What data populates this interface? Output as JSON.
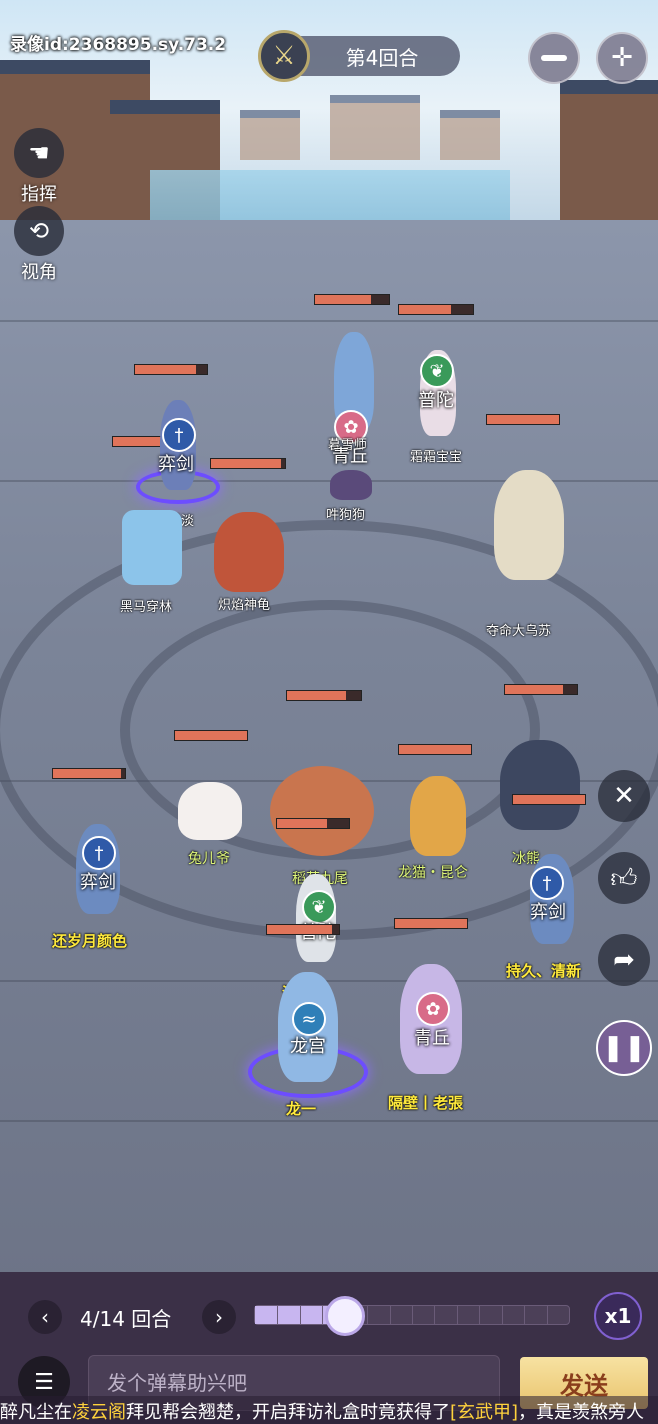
{
  "hud": {
    "replay_id": "录像id:2368895.sy.73.2",
    "round_label": "第4回合",
    "minimize_icon": "minus-icon",
    "fullscreen_icon": "crosshair-icon"
  },
  "side_tools": [
    {
      "label": "指挥",
      "icon": "hand-icon"
    },
    {
      "label": "视角",
      "icon": "camera-angle-icon"
    }
  ],
  "enemy_units": [
    {
      "name": "看淡",
      "school": "弈剑",
      "hp": 0.85
    },
    {
      "name": "黑马穿林",
      "school": "",
      "hp": 0.0
    },
    {
      "name": "炽焰神龟",
      "school": "",
      "hp": 0.95
    },
    {
      "name": "暮雪师",
      "school": "青丘",
      "hp": 0.75
    },
    {
      "name": "吽狗狗",
      "school": "",
      "hp": 0.0
    },
    {
      "name": "霜霜宝宝",
      "school": "普陀",
      "hp": 0.7
    },
    {
      "name": "夺命大乌苏",
      "school": "",
      "hp": 1.0
    }
  ],
  "ally_units": [
    {
      "name": "兔儿爷",
      "school": "",
      "hp": 1.0
    },
    {
      "name": "稻荷九尾",
      "school": "",
      "hp": 0.8
    },
    {
      "name": "龙猫・昆仑",
      "school": "",
      "hp": 1.0
    },
    {
      "name": "冰熊",
      "school": "",
      "hp": 0.8
    },
    {
      "name": "还岁月颜色",
      "school": "弈剑",
      "hp": 0.95
    },
    {
      "name": "浮",
      "school": "普陀",
      "hp": 0.7
    },
    {
      "name": "持久、清新",
      "school": "弈剑",
      "hp": 1.0
    },
    {
      "name": "龙一",
      "school": "龙宫",
      "hp": 0.9
    },
    {
      "name": "隔壁丨老張",
      "school": "青丘",
      "hp": 1.0
    }
  ],
  "right_buttons": [
    {
      "name": "close",
      "icon": "close-icon"
    },
    {
      "name": "like",
      "icon": "thumbs-up-icon"
    },
    {
      "name": "share",
      "icon": "share-arrow-icon"
    },
    {
      "name": "pause",
      "icon": "pause-icon"
    }
  ],
  "playback": {
    "prev_icon": "chevron-left-icon",
    "next_icon": "chevron-right-icon",
    "round_counter": "4/14 回合",
    "current_round": 4,
    "total_rounds": 14,
    "progress": 0.286,
    "speed": "x1"
  },
  "danmaku": {
    "placeholder": "发个弹幕助兴吧",
    "send_label": "发送",
    "chat_icon": "chat-list-icon"
  },
  "ticker": {
    "prefix": "醉凡尘在",
    "place": "凌云阁",
    "mid": "拜见帮会翘楚，开启拜访礼盒时竟获得了",
    "item": "[玄武甲]",
    "suffix": "，真是羡煞旁人"
  },
  "colors": {
    "hp_fill": "#e0745a",
    "ally_name": "#ffea3c",
    "aura": "#6d4dff",
    "send_bg": "#e9c46e"
  }
}
